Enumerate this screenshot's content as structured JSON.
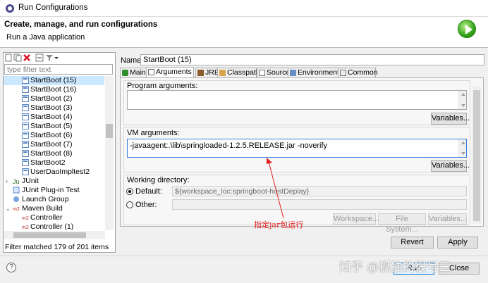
{
  "window": {
    "title": "Run Configurations"
  },
  "banner": {
    "heading": "Create, manage, and run configurations",
    "subheading": "Run a Java application"
  },
  "left": {
    "filter_placeholder": "type filter text",
    "tree": [
      {
        "label": "StartBoot (15)",
        "selected": true
      },
      {
        "label": "StartBoot (16)"
      },
      {
        "label": "StartBoot (2)"
      },
      {
        "label": "StartBoot (3)"
      },
      {
        "label": "StartBoot (4)"
      },
      {
        "label": "StartBoot (5)"
      },
      {
        "label": "StartBoot (6)"
      },
      {
        "label": "StartBoot (7)"
      },
      {
        "label": "StartBoot (8)"
      },
      {
        "label": "StartBoot2"
      },
      {
        "label": "UserDaoImpltest2"
      },
      {
        "label": "JUnit"
      },
      {
        "label": "JUnit Plug-in Test"
      },
      {
        "label": "Launch Group"
      },
      {
        "label": "Maven Build"
      },
      {
        "label": "Controller"
      },
      {
        "label": "Controller (1)"
      }
    ],
    "status": "Filter matched 179 of 201 items"
  },
  "right": {
    "name_label": "Name:",
    "name_value": "StartBoot (15)",
    "tabs": [
      "Main",
      "Arguments",
      "JRE",
      "Classpath",
      "Source",
      "Environment",
      "Common"
    ],
    "program_args_label": "Program arguments:",
    "program_args_value": "",
    "variables_label": "Variables...",
    "vm_args_label": "VM arguments:",
    "vm_args_value": "-javaagent:.\\lib\\springloaded-1.2.5.RELEASE.jar -noverify",
    "workdir_label": "Working directory:",
    "default_label": "Default:",
    "default_value": "${workspace_loc:springboot-hostDeplay}",
    "other_label": "Other:",
    "other_value": "",
    "workspace_btn": "Workspace...",
    "filesystem_btn": "File System...",
    "revert_btn": "Revert",
    "apply_btn": "Apply"
  },
  "annotation": "指定jar包运行",
  "footer": {
    "help": "?",
    "run_btn": "Run",
    "close_btn": "Close"
  },
  "watermark": "知乎 @孤独的很号三"
}
